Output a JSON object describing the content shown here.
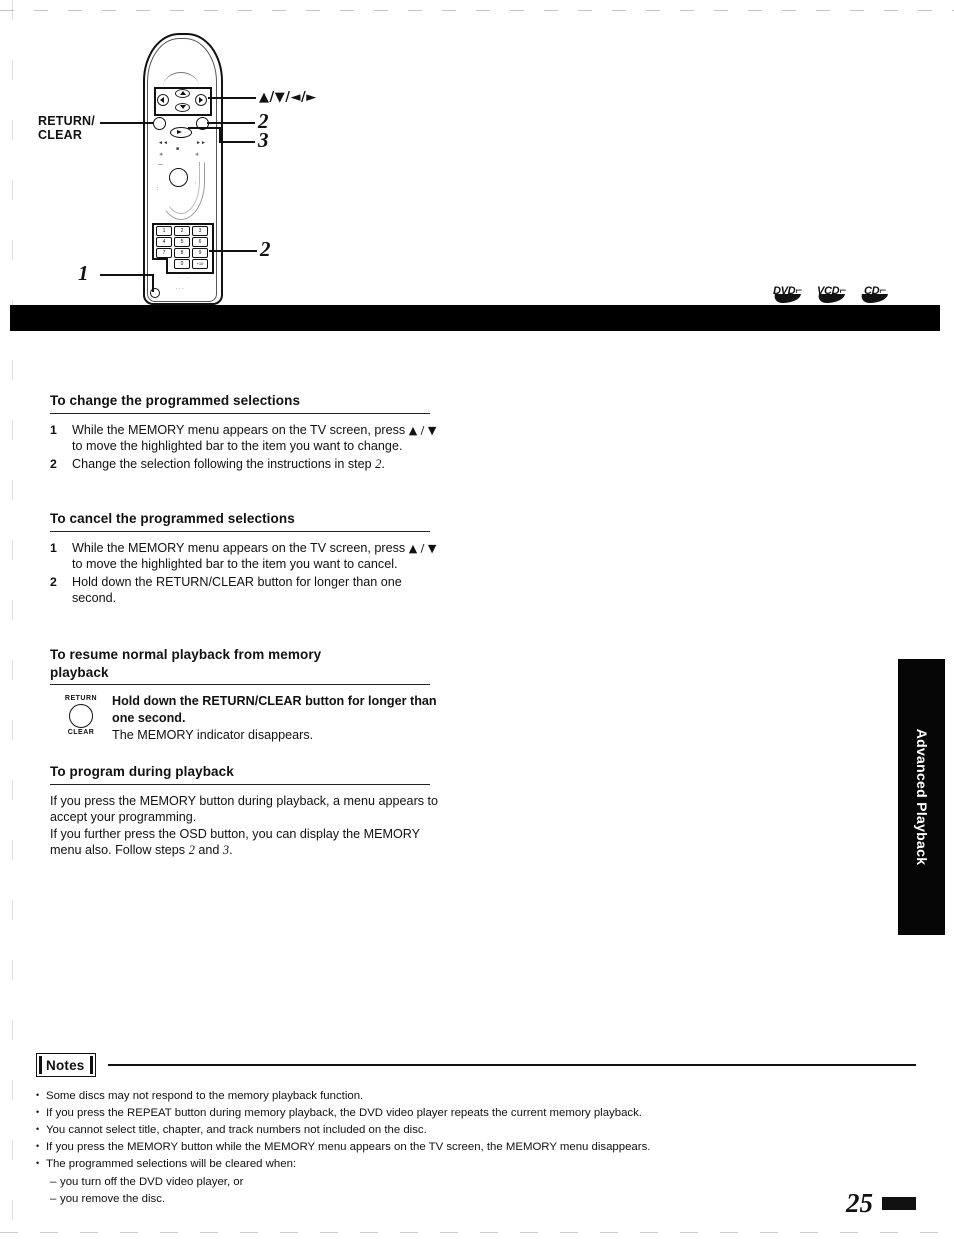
{
  "figure": {
    "callouts": {
      "return_clear": "RETURN/\nCLEAR",
      "return_clear_line1": "RETURN/",
      "return_clear_line2": "CLEAR",
      "dpad_arrows": "▲/▼/◄/►",
      "num_two_top": "2",
      "num_three": "3",
      "num_two_keypad": "2",
      "num_one": "1"
    },
    "keypad_keys": [
      "1",
      "2",
      "3",
      "4",
      "5",
      "6",
      "7",
      "8",
      "9",
      "0",
      "+10"
    ],
    "disc_badges": [
      "DVD",
      "VCD",
      "CD"
    ]
  },
  "sections": [
    {
      "heading": "To change the programmed selections",
      "steps": [
        {
          "num": "1",
          "text_a": "While the MEMORY menu appears on the TV screen, press ",
          "arrows": "▲ / ▼",
          "text_b": " to move the highlighted bar to the item you want to change."
        },
        {
          "num": "2",
          "text_a": "Change the selection following the instructions in step ",
          "italic": "2",
          "text_b": "."
        }
      ]
    },
    {
      "heading": "To cancel the programmed selections",
      "steps": [
        {
          "num": "1",
          "text_a": "While the MEMORY menu appears on the TV screen, press ",
          "arrows": "▲ / ▼",
          "text_b": " to move the highlighted bar to the item you want to cancel."
        },
        {
          "num": "2",
          "text_a": "Hold down the RETURN/CLEAR button for longer than one second.",
          "italic": "",
          "text_b": ""
        }
      ]
    }
  ],
  "resume_section": {
    "heading_line1": "To resume normal playback from memory",
    "heading_line2": "playback",
    "icon": {
      "top_label": "RETURN",
      "bottom_label": "CLEAR"
    },
    "bold_text": "Hold down the RETURN/CLEAR button for longer than one second.",
    "normal_text": "The MEMORY indicator disappears."
  },
  "program_section": {
    "heading": "To program during playback",
    "para_1": "If you press the MEMORY button during playback, a menu appears to accept your programming.",
    "para_2_a": "If you further press the OSD button, you can display the MEMORY menu also.  Follow steps ",
    "para_2_italic_1": "2",
    "para_2_mid": " and ",
    "para_2_italic_2": "3",
    "para_2_end": "."
  },
  "notes": {
    "title": "Notes",
    "items": [
      "Some discs may not respond to the memory playback function.",
      "If you press the REPEAT button during memory playback, the DVD video player repeats the current memory playback.",
      "You cannot select title, chapter, and track numbers not included on the disc.",
      "If you press the MEMORY button while the MEMORY menu appears on the TV screen, the MEMORY menu disappears.",
      "The programmed selections will be cleared when:"
    ],
    "sub_items": [
      "you turn off the DVD video player, or",
      "you remove the disc."
    ],
    "bullet": "•",
    "dash": "–"
  },
  "side_tab": {
    "label": "Advanced Playback"
  },
  "footer": {
    "page_number": "25"
  }
}
